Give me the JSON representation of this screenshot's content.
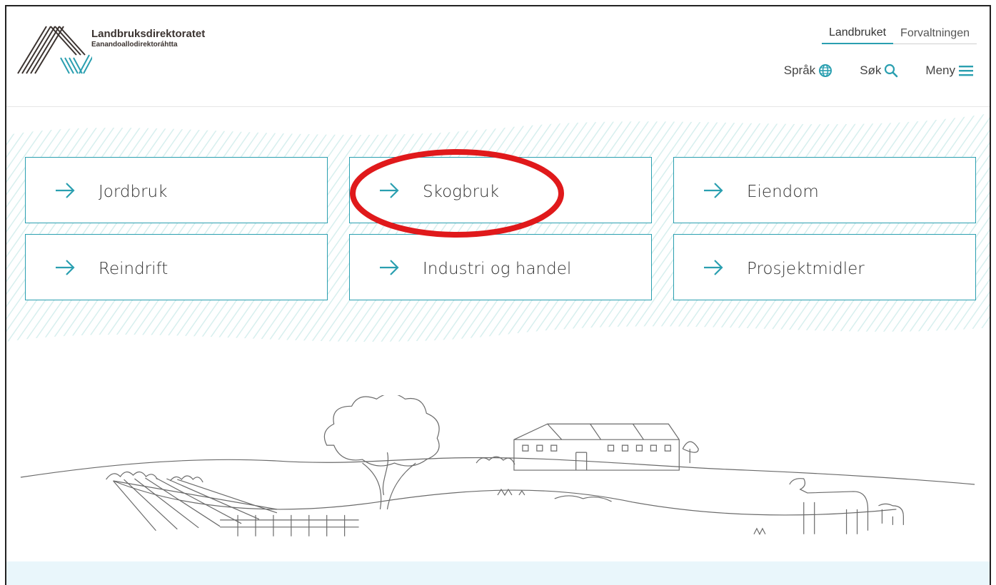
{
  "brand": {
    "title": "Landbruksdirektoratet",
    "subtitle": "Eanandoallodirektoráhtta",
    "accent": "#2a9fb0",
    "text_dark": "#3b3330"
  },
  "top_tabs": [
    {
      "label": "Landbruket",
      "active": true
    },
    {
      "label": "Forvaltningen",
      "active": false
    }
  ],
  "tools": {
    "language": {
      "label": "Språk",
      "icon": "globe-icon"
    },
    "search": {
      "label": "Søk",
      "icon": "search-icon"
    },
    "menu": {
      "label": "Meny",
      "icon": "hamburger-icon"
    }
  },
  "cards": [
    {
      "label": "Jordbruk",
      "icon": "arrow-right-icon"
    },
    {
      "label": "Skogbruk",
      "icon": "arrow-right-icon",
      "highlighted": true
    },
    {
      "label": "Eiendom",
      "icon": "arrow-right-icon"
    },
    {
      "label": "Reindrift",
      "icon": "arrow-right-icon"
    },
    {
      "label": "Industri og handel",
      "icon": "arrow-right-icon"
    },
    {
      "label": "Prosjektmidler",
      "icon": "arrow-right-icon"
    }
  ],
  "annotation": {
    "color": "#e0191b",
    "shape": "ellipse"
  },
  "footer_band_color": "#e9f6fb"
}
